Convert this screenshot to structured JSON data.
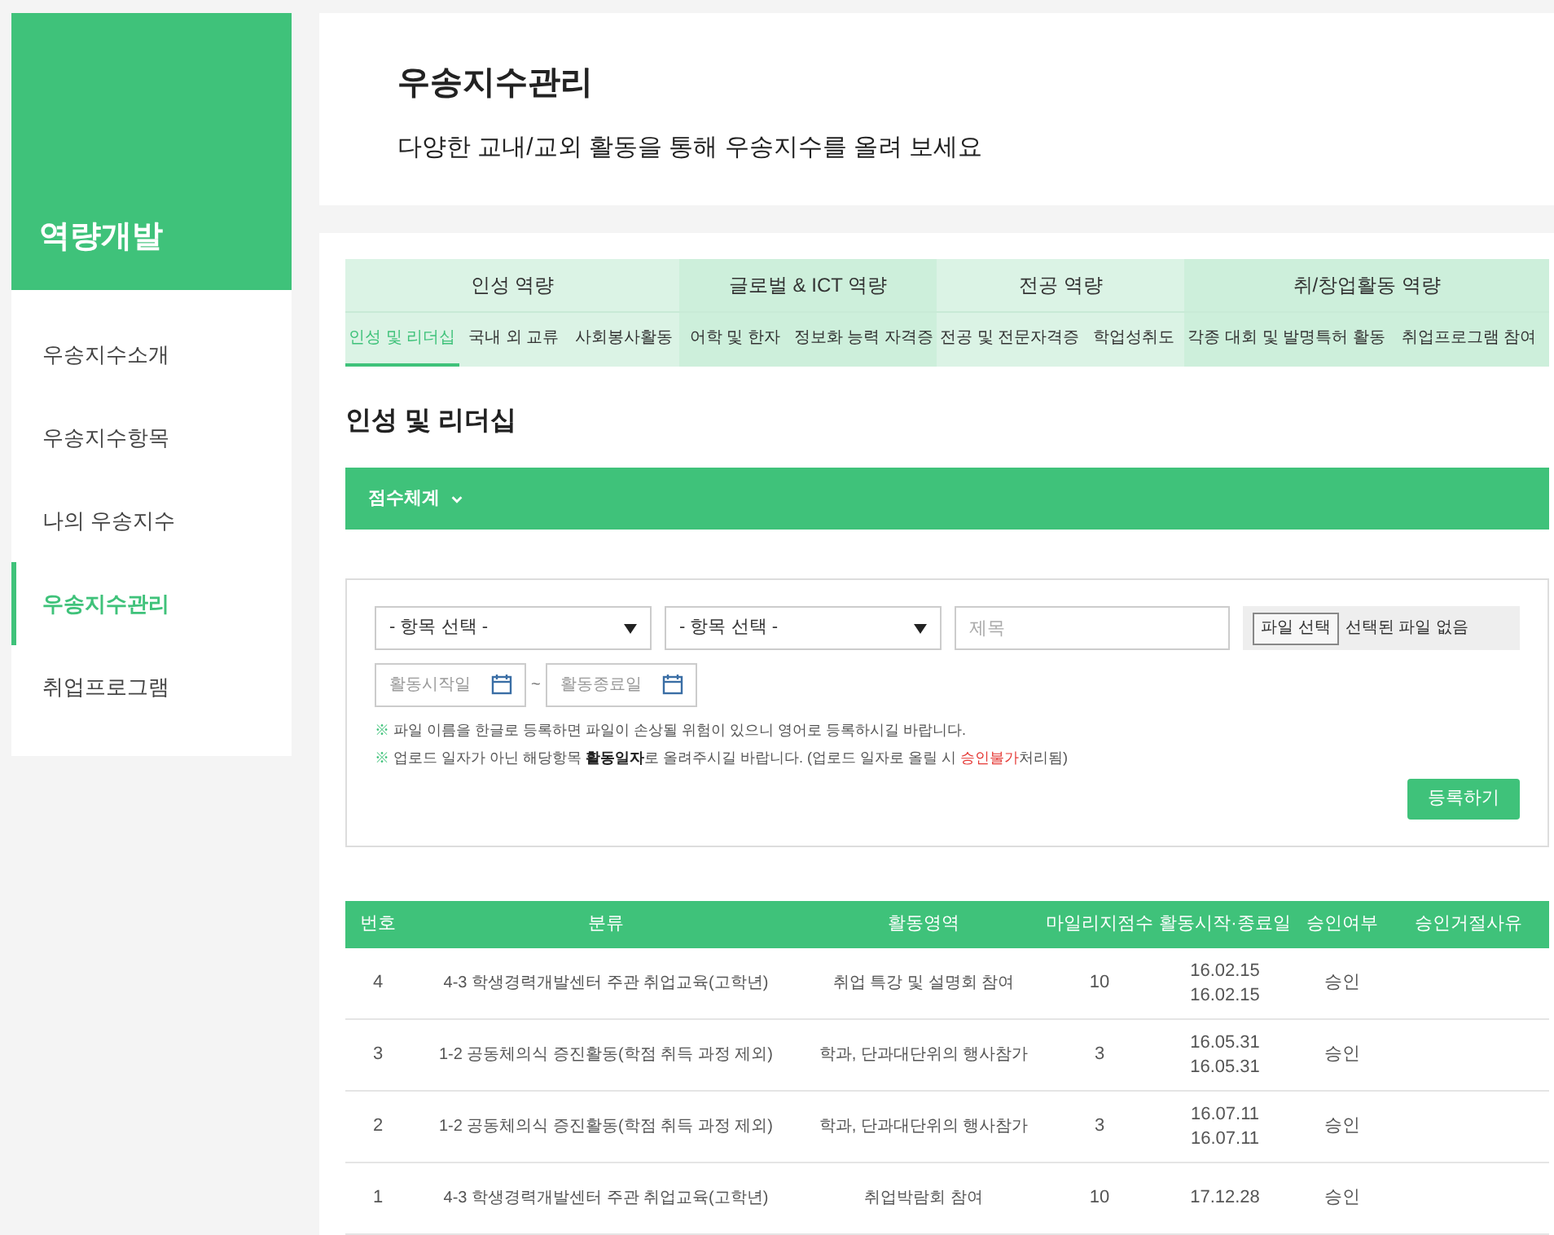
{
  "sidebar": {
    "title": "역량개발",
    "items": [
      {
        "label": "우송지수소개",
        "selected": false
      },
      {
        "label": "우송지수항목",
        "selected": false
      },
      {
        "label": "나의 우송지수",
        "selected": false
      },
      {
        "label": "우송지수관리",
        "selected": true
      },
      {
        "label": "취업프로그램",
        "selected": false
      }
    ]
  },
  "header": {
    "title": "우송지수관리",
    "subtitle": "다양한 교내/교외 활동을 통해 우송지수를 올려 보세요"
  },
  "tab_groups": [
    {
      "label": "인성 역량",
      "tabs": [
        {
          "label": "인성 및 리더십",
          "selected": true
        },
        {
          "label": "국내 외 교류",
          "selected": false
        },
        {
          "label": "사회봉사활동",
          "selected": false
        }
      ]
    },
    {
      "label": "글로벌 & ICT 역량",
      "tabs": [
        {
          "label": "어학 및 한자",
          "selected": false
        },
        {
          "label": "정보화 능력 자격증",
          "selected": false
        }
      ]
    },
    {
      "label": "전공 역량",
      "tabs": [
        {
          "label": "전공 및 전문자격증",
          "selected": false
        },
        {
          "label": "학업성취도",
          "selected": false
        }
      ]
    },
    {
      "label": "취/창업활동 역량",
      "tabs": [
        {
          "label": "각종 대회 및 발명특허 활동",
          "selected": false
        },
        {
          "label": "취업프로그램 참여",
          "selected": false
        }
      ]
    }
  ],
  "section_title": "인성 및 리더십",
  "score_toggle": {
    "label": "점수체계",
    "expanded": false
  },
  "form": {
    "select_1": "- 항목 선택 -",
    "select_2": "- 항목 선택 -",
    "title_placeholder": "제목",
    "file_button": "파일 선택",
    "file_status": "선택된 파일 없음",
    "start_placeholder": "활동시작일",
    "separator": "~",
    "end_placeholder": "활동종료일",
    "notes": [
      [
        {
          "kind": "mark",
          "text": "※"
        },
        {
          "kind": "plain",
          "text": " 파일 이름을 한글로 등록하면 파일이 손상될 위험이 있으니 영어로 등록하시길 바랍니다."
        }
      ],
      [
        {
          "kind": "mark",
          "text": "※"
        },
        {
          "kind": "plain",
          "text": " 업로드 일자가 아닌 해당항목 "
        },
        {
          "kind": "bold",
          "text": "활동일자"
        },
        {
          "kind": "plain",
          "text": "로 올려주시길 바랍니다. (업로드 일자로 올릴 시 "
        },
        {
          "kind": "warning",
          "text": "승인불가"
        },
        {
          "kind": "plain",
          "text": "처리됨)"
        }
      ]
    ],
    "submit": "등록하기"
  },
  "table": {
    "columns": [
      "번호",
      "분류",
      "활동영역",
      "마일리지점수",
      "활동시작·종료일",
      "승인여부",
      "승인거절사유"
    ],
    "rows": [
      {
        "no": "4",
        "category": "4-3 학생경력개발센터 주관 취업교육(고학년)",
        "area": "취업 특강 및 설명회 참여",
        "points": "10",
        "start": "16.02.15",
        "end": "16.02.15",
        "status": "승인"
      },
      {
        "no": "3",
        "category": "1-2 공동체의식 증진활동(학점 취득 과정 제외)",
        "area": "학과, 단과대단위의 행사참가",
        "points": "3",
        "start": "16.05.31",
        "end": "16.05.31",
        "status": "승인"
      },
      {
        "no": "2",
        "category": "1-2 공동체의식 증진활동(학점 취득 과정 제외)",
        "area": "학과, 단과대단위의 행사참가",
        "points": "3",
        "start": "16.07.11",
        "end": "16.07.11",
        "status": "승인"
      },
      {
        "no": "1",
        "category": "4-3 학생경력개발센터 주관 취업교육(고학년)",
        "area": "취업박람회 참여",
        "points": "10",
        "start": "17.12.28",
        "status": "승인"
      }
    ]
  }
}
